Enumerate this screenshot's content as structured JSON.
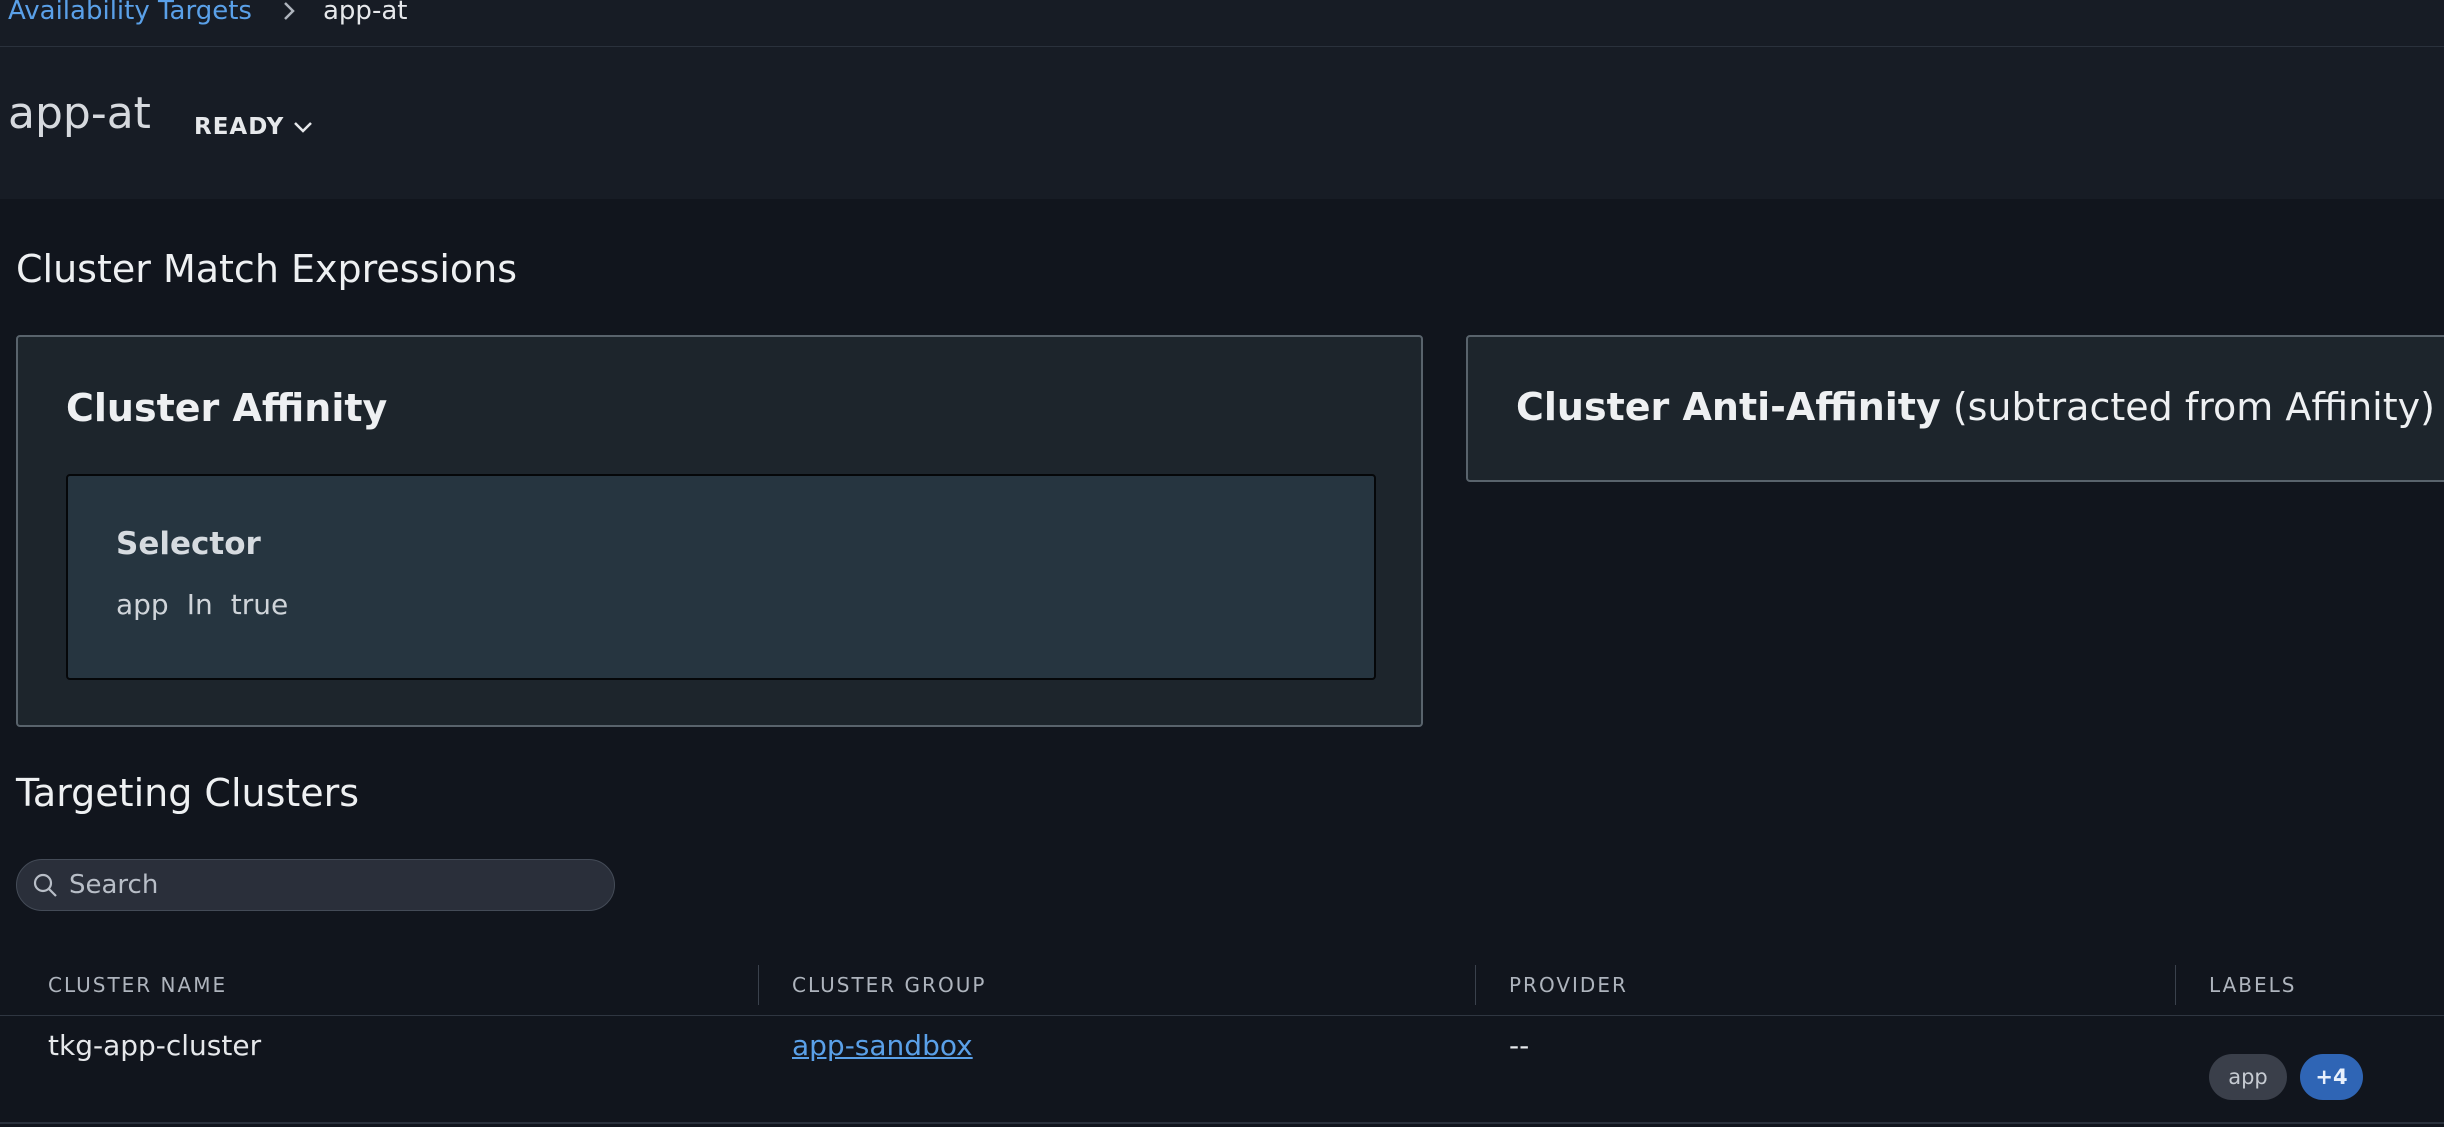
{
  "breadcrumb": {
    "parent": "Availability Targets",
    "current": "app-at"
  },
  "header": {
    "title": "app-at",
    "status": "READY"
  },
  "match_section": {
    "title": "Cluster Match Expressions"
  },
  "affinity": {
    "title": "Cluster Affinity",
    "selector": {
      "title": "Selector",
      "key": "app",
      "operator": "In",
      "value": "true"
    }
  },
  "anti_affinity": {
    "title_bold": "Cluster Anti-Affinity",
    "title_note": "(subtracted from Affinity)"
  },
  "targeting": {
    "title": "Targeting Clusters",
    "search": {
      "placeholder": "Search",
      "value": ""
    },
    "columns": [
      "CLUSTER NAME",
      "CLUSTER GROUP",
      "PROVIDER",
      "LABELS"
    ],
    "rows": [
      {
        "name": "tkg-app-cluster",
        "group": "app-sandbox",
        "provider": "--",
        "labels": [
          "app",
          "+4"
        ]
      }
    ]
  },
  "colors": {
    "link": "#5aa0e8",
    "chip_accent": "#2f65b5",
    "background": "#11151d"
  }
}
